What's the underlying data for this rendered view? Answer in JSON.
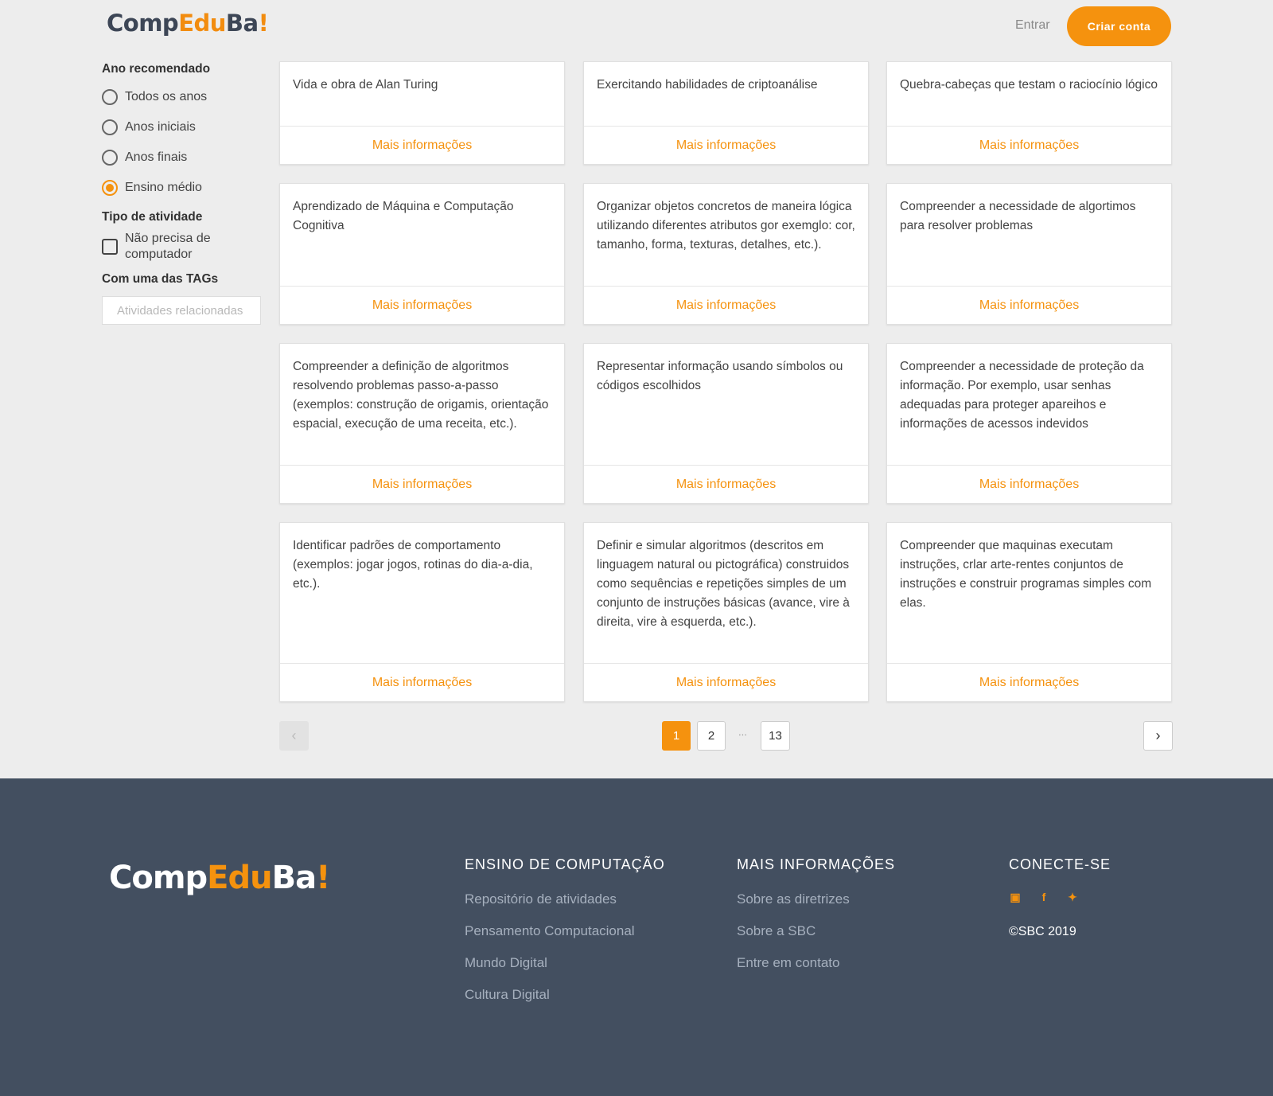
{
  "header": {
    "logo": {
      "p1": "Comp",
      "p2": "Edu",
      "p3": "Ba",
      "p4": "!"
    },
    "login": "Entrar",
    "signup": "Criar conta"
  },
  "sidebar": {
    "year_heading": "Ano recomendado",
    "year_options": [
      {
        "label": "Todos os anos",
        "selected": false
      },
      {
        "label": "Anos iniciais",
        "selected": false
      },
      {
        "label": "Anos finais",
        "selected": false
      },
      {
        "label": "Ensino médio",
        "selected": true
      }
    ],
    "type_heading": "Tipo de atividade",
    "no_computer": "Não precisa de computador",
    "tags_heading": "Com uma das TAGs",
    "tags_placeholder": "Atividades relacionadas"
  },
  "cards": [
    {
      "text": "Vida e obra de Alan Turing",
      "link": "Mais informações"
    },
    {
      "text": "Exercitando habilidades de criptoanálise",
      "link": "Mais informações"
    },
    {
      "text": "Quebra-cabeças que testam o raciocínio lógico",
      "link": "Mais informações"
    },
    {
      "text": "Aprendizado de Máquina e Computação Cognitiva",
      "link": "Mais informações"
    },
    {
      "text": "Organizar objetos concretos de maneira lógica utilizando diferentes atributos gor exemglo: cor, tamanho, forma, texturas, detalhes, etc.).",
      "link": "Mais informações"
    },
    {
      "text": "Compreender a necessidade de algortimos para resolver problemas",
      "link": "Mais informações"
    },
    {
      "text": "Compreender a definição de algoritmos resolvendo problemas passo-a-passo (exemplos: construção de origamis, orientação espacial, execução de uma receita, etc.).",
      "link": "Mais informações"
    },
    {
      "text": "Representar informação usando símbolos ou códigos escolhidos",
      "link": "Mais informações"
    },
    {
      "text": "Compreender a necessidade de proteção da informação. Por exemplo, usar senhas adequadas para proteger apareihos e informações de acessos indevidos",
      "link": "Mais informações"
    },
    {
      "text": "Identificar padrões de comportamento (exemplos: jogar jogos, rotinas do dia-a-dia, etc.).",
      "link": "Mais informações"
    },
    {
      "text": "Definir e simular algoritmos (descritos em linguagem natural ou pictográfica) construidos como sequências e repetições simples de um conjunto de instruções básicas (avance, vire à direita, vire à esquerda, etc.).",
      "link": "Mais informações"
    },
    {
      "text": "Compreender que maquinas executam instruções, crlar arte-rentes conjuntos de instruções e construir programas simples com elas.",
      "link": "Mais informações"
    }
  ],
  "pagination": {
    "prev_icon": "chevron-left-icon",
    "pages": [
      "1",
      "2",
      "13"
    ],
    "current": "1",
    "dots": "...",
    "next_icon": "chevron-right-icon"
  },
  "footer": {
    "logo": {
      "p1": "Comp",
      "p2": "Edu",
      "p3": "Ba",
      "p4": "!"
    },
    "col1": {
      "title": "ENSINO DE COMPUTAÇÃO",
      "links": [
        "Repositório de atividades",
        "Pensamento Computacional",
        "Mundo Digital",
        "Cultura Digital"
      ]
    },
    "col2": {
      "title": "MAIS INFORMAÇÕES",
      "links": [
        "Sobre as diretrizes",
        "Sobre a SBC",
        "Entre em contato"
      ]
    },
    "col3": {
      "title": "CONECTE-SE",
      "social_icons": [
        "youtube-icon",
        "facebook-icon",
        "twitter-icon"
      ],
      "copyright": "©SBC 2019"
    }
  },
  "colors": {
    "accent": "#f5920e",
    "footer_bg": "#434f60",
    "page_bg": "#ededed"
  }
}
